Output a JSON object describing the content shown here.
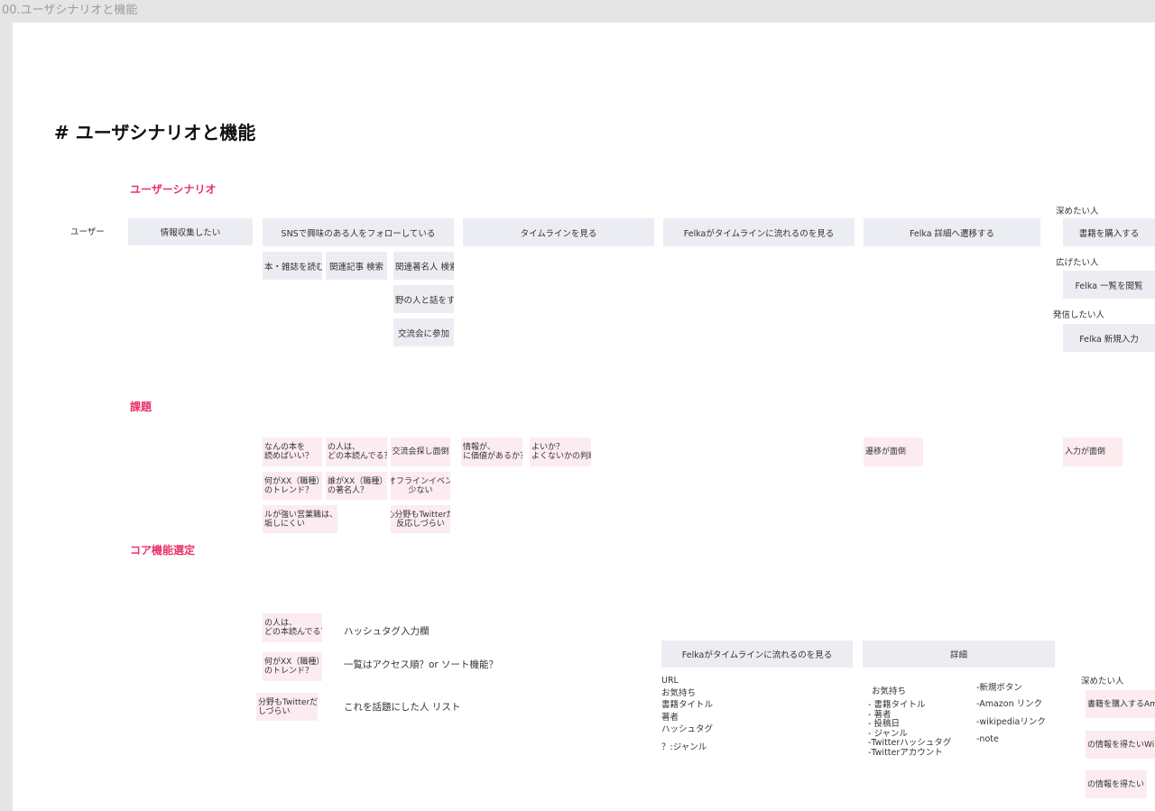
{
  "frame_title": "00.ユーザシナリオと機能",
  "heading": "# ユーザシナリオと機能",
  "sections": {
    "scenario": "ユーザーシナリオ",
    "issues": "課題",
    "core": "コア機能選定"
  },
  "user_label": "ユーザー",
  "scenario": {
    "steps": [
      "情報収集したい",
      "SNSで興味のある人をフォローしている",
      "タイムラインを見る",
      "Felkaがタイムラインに流れるのを見る",
      "Felka 詳細へ遷移する",
      "書籍を購入する"
    ],
    "sub": {
      "read": "本・雑誌を読む",
      "related_search": "関連記事 検索",
      "author_search": "関連著名人 検索",
      "talk": "野の人と話をする",
      "meetup": "交流会に参加"
    },
    "right_labels": {
      "deepen": "深めたい人",
      "broaden": "広げたい人",
      "share": "発信したい人"
    },
    "right_boxes": {
      "list": "Felka 一覧を閲覧",
      "new": "Felka 新規入力"
    }
  },
  "issues": {
    "q1": "なんの本を\n読めばいい？",
    "q2": "の人は、\nどの本読んでる？",
    "q3": "交流会探し面倒",
    "q4": "何がXX（職種）\nのトレンド？",
    "q5": "誰がXX（職種）\nの著名人？",
    "q6": "オフラインイベン\n少ない",
    "q7": "ルが強い営業職は、\n垢しにくい",
    "q8": "心分野もTwitterだ\n反応しづらい",
    "q9": "情報が、\nに価値があるか？",
    "q10": "よいか？\nよくないかの判断",
    "transition": "遷移が面倒",
    "input": "入力が面倒"
  },
  "core": {
    "left_boxes": [
      "の人は、\nどの本読んでる？",
      "何がXX（職種）\nのトレンド？",
      "分野もTwitterだ\nしづらい"
    ],
    "features": [
      "ハッシュタグ入力欄",
      "一覧はアクセス順？or ソート機能？",
      "これを話題にした人 リスト"
    ],
    "timeline_box": "Felkaがタイムラインに流れるのを見る",
    "timeline_items": "URL\nお気持ち\n書籍タイトル\n著者\nハッシュタグ",
    "timeline_genre": "？:ジャンル",
    "detail_box": "詳細",
    "detail_items": "お気持ち",
    "detail_list": "- 書籍タイトル\n- 著者\n- 投稿日\n- ジャンル\n-Twitterハッシュタグ\n-Twitterアカウント",
    "detail_right": [
      "-新規ボタン",
      "-Amazon リンク",
      "-wikipediaリンク",
      "-note"
    ],
    "deepen_label": "深めたい人",
    "right_boxes": [
      "書籍を購入するAma",
      "の情報を得たいWi",
      "の情報を得たい"
    ]
  }
}
